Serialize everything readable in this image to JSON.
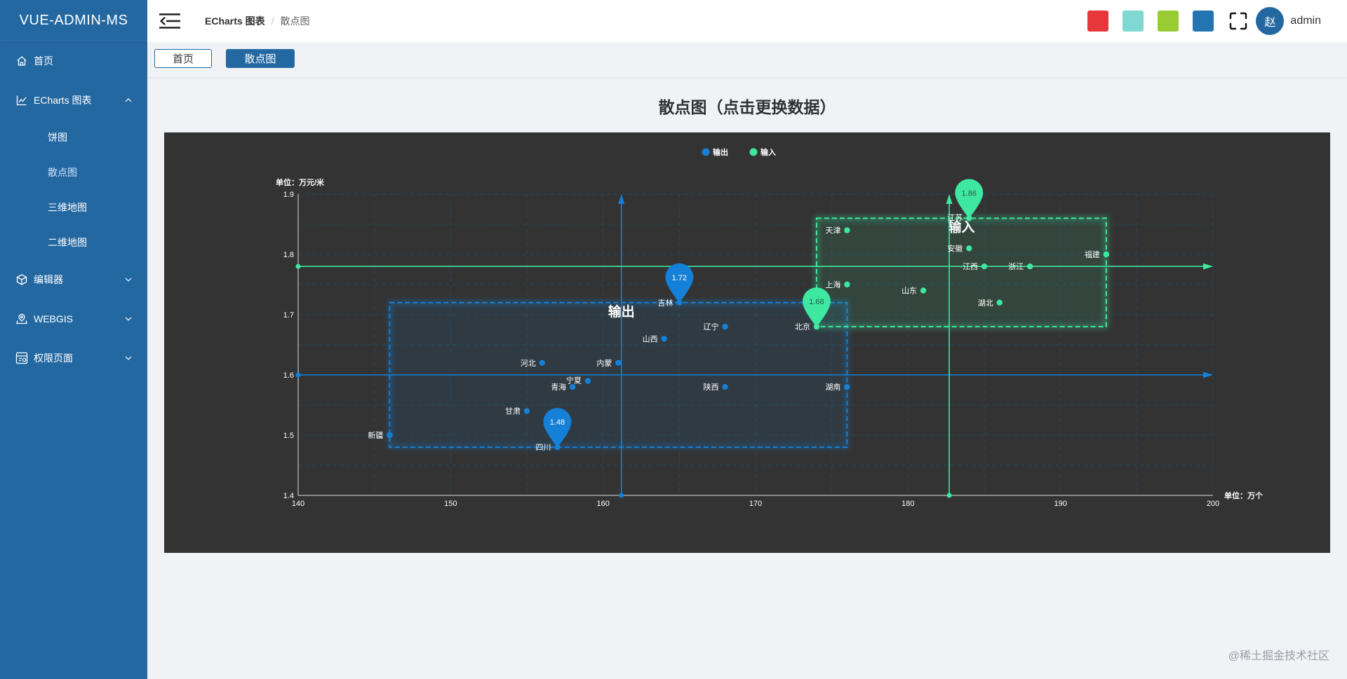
{
  "app": {
    "title": "VUE-ADMIN-MS"
  },
  "sidebar": {
    "items": [
      {
        "label": "首页",
        "icon": "home-icon"
      },
      {
        "label": "ECharts 图表",
        "icon": "chart-icon",
        "expanded": true,
        "children": [
          {
            "label": "饼图"
          },
          {
            "label": "散点图",
            "active": true
          },
          {
            "label": "三维地图"
          },
          {
            "label": "二维地图"
          }
        ]
      },
      {
        "label": "编辑器",
        "icon": "cube-icon",
        "expanded": false
      },
      {
        "label": "WEBGIS",
        "icon": "map-icon",
        "expanded": false
      },
      {
        "label": "权限页面",
        "icon": "permission-icon",
        "expanded": false
      }
    ]
  },
  "header": {
    "breadcrumb": [
      "ECharts 图表",
      "散点图"
    ],
    "theme_colors": [
      "#e6373a",
      "#7fd8d2",
      "#99cc33",
      "#2474b2"
    ],
    "avatar_text": "赵",
    "username": "admin"
  },
  "tags": [
    "首页",
    "散点图"
  ],
  "page": {
    "title": "散点图（点击更换数据）"
  },
  "watermark": "@稀土掘金技术社区",
  "chart_data": {
    "type": "scatter",
    "background": "#333333",
    "legend": [
      "输出",
      "输入"
    ],
    "legend_position": "top-center",
    "xlabel": "单位：万个",
    "ylabel": "单位：万元/米",
    "xlim": [
      140,
      200
    ],
    "ylim": [
      1.4,
      1.9
    ],
    "xticks": [
      "140",
      "150",
      "160",
      "170",
      "180",
      "190",
      "200"
    ],
    "yticks": [
      "1.4",
      "1.5",
      "1.6",
      "1.7",
      "1.8",
      "1.9"
    ],
    "grid": true,
    "series": [
      {
        "name": "输出",
        "color": "#1580d8",
        "points": [
          {
            "label": "新疆",
            "x": 146,
            "y": 1.5
          },
          {
            "label": "甘肃",
            "x": 155,
            "y": 1.54
          },
          {
            "label": "四川",
            "x": 157,
            "y": 1.48
          },
          {
            "label": "青海",
            "x": 158,
            "y": 1.58
          },
          {
            "label": "宁夏",
            "x": 159,
            "y": 1.59
          },
          {
            "label": "河北",
            "x": 156,
            "y": 1.62
          },
          {
            "label": "内蒙",
            "x": 161,
            "y": 1.62
          },
          {
            "label": "山西",
            "x": 164,
            "y": 1.66
          },
          {
            "label": "吉林",
            "x": 165,
            "y": 1.72
          },
          {
            "label": "辽宁",
            "x": 168,
            "y": 1.68
          },
          {
            "label": "陕西",
            "x": 168,
            "y": 1.58
          },
          {
            "label": "湖南",
            "x": 176,
            "y": 1.58
          }
        ],
        "markpoints": [
          {
            "label": "1.72",
            "x": 165,
            "y": 1.72
          },
          {
            "label": "1.48",
            "x": 157,
            "y": 1.48
          }
        ],
        "avg_line": {
          "x": 161.2,
          "y": 1.6
        },
        "area_label": "输出",
        "area": {
          "x": [
            146,
            176
          ],
          "y": [
            1.48,
            1.72
          ]
        }
      },
      {
        "name": "输入",
        "color": "#3ee8a0",
        "points": [
          {
            "label": "北京",
            "x": 174,
            "y": 1.68
          },
          {
            "label": "天津",
            "x": 176,
            "y": 1.84
          },
          {
            "label": "上海",
            "x": 176,
            "y": 1.75
          },
          {
            "label": "山东",
            "x": 181,
            "y": 1.74
          },
          {
            "label": "江苏",
            "x": 184,
            "y": 1.86
          },
          {
            "label": "安徽",
            "x": 184,
            "y": 1.81
          },
          {
            "label": "江西",
            "x": 185,
            "y": 1.78
          },
          {
            "label": "湖北",
            "x": 186,
            "y": 1.72
          },
          {
            "label": "浙江",
            "x": 188,
            "y": 1.78
          },
          {
            "label": "福建",
            "x": 193,
            "y": 1.8
          }
        ],
        "markpoints": [
          {
            "label": "1.86",
            "x": 184,
            "y": 1.86
          },
          {
            "label": "1.68",
            "x": 174,
            "y": 1.68
          }
        ],
        "avg_line": {
          "x": 182.7,
          "y": 1.78
        },
        "area_label": "输入",
        "area": {
          "x": [
            174,
            193
          ],
          "y": [
            1.68,
            1.86
          ]
        }
      }
    ]
  }
}
